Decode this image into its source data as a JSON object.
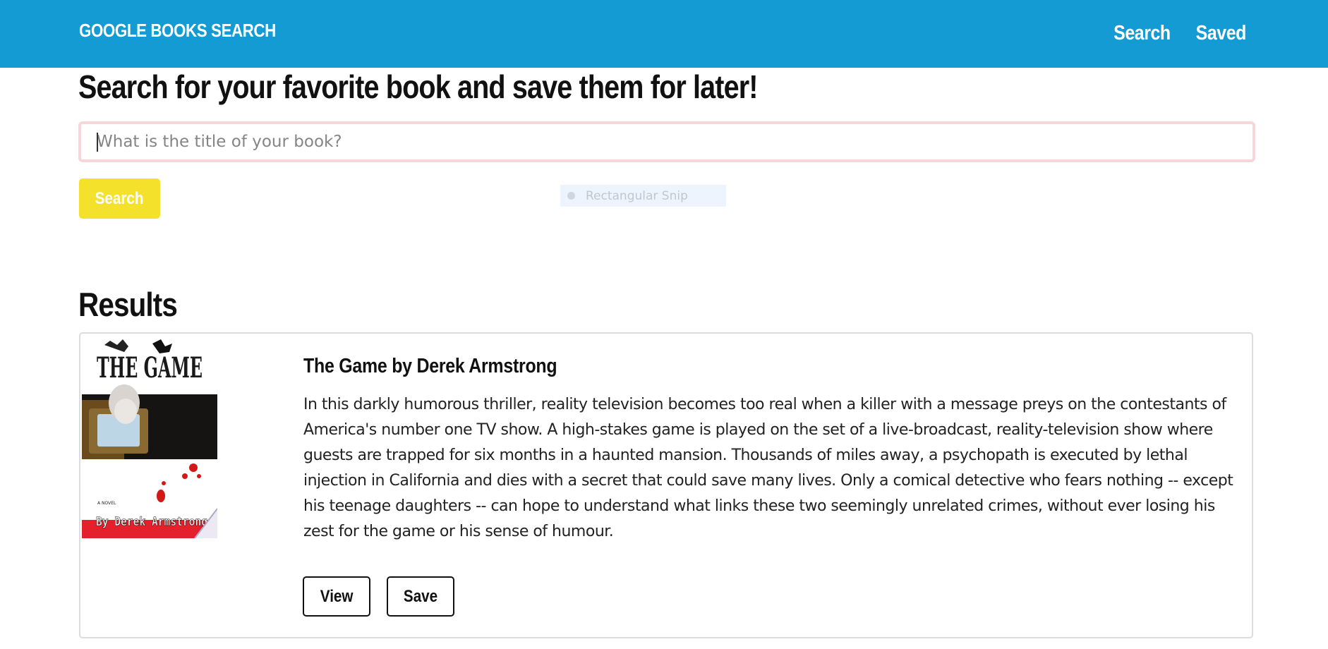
{
  "navbar": {
    "brand": "GOOGLE BOOKS SEARCH",
    "links": [
      "Search",
      "Saved"
    ],
    "color": "#149bd4"
  },
  "search": {
    "heading": "Search for your favorite book and save them for later!",
    "placeholder": "What is the title of your book?",
    "value": "",
    "button_label": "Search",
    "button_color": "#f4e12c"
  },
  "snip_overlay": {
    "label": "Rectangular Snip"
  },
  "results": {
    "title": "Results",
    "items": [
      {
        "title": "The Game by Derek Armstrong",
        "description": "In this darkly humorous thriller, reality television becomes too real when a killer with a message preys on the contestants of America's number one TV show. A high-stakes game is played on the set of a live-broadcast, reality-television show where guests are trapped for six months in a haunted mansion. Thousands of miles away, a psychopath is executed by lethal injection in California and dies with a secret that could save many lives. Only a comical detective who fears nothing -- except his teenage daughters -- can hope to understand what links these two seemingly unrelated crimes, without ever losing his zest for the game or his sense of humour.",
        "cover_text": {
          "title": "THE GAME",
          "tagline": "A NOVEL",
          "author": "By Derek Armstrong"
        },
        "view_label": "View",
        "save_label": "Save"
      }
    ]
  }
}
